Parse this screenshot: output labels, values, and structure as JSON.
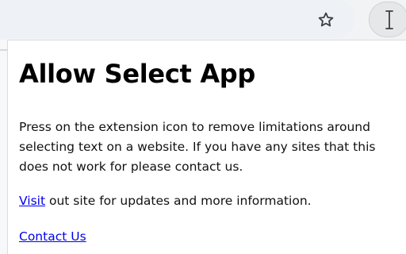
{
  "toolbar": {
    "star_icon": "star-outline-icon",
    "extension_icon": "text-cursor-icon"
  },
  "popup": {
    "title": "Allow Select App",
    "description": "Press on the extension icon to remove limitations around selecting text on a website. If you have any sites that this does not work for please contact us.",
    "visit_link": "Visit",
    "visit_rest": " out site for updates and more information.",
    "contact_link": "Contact Us"
  },
  "colors": {
    "link": "#0000ee",
    "toolbar_bg": "#f1f3f4",
    "text": "#000000"
  }
}
